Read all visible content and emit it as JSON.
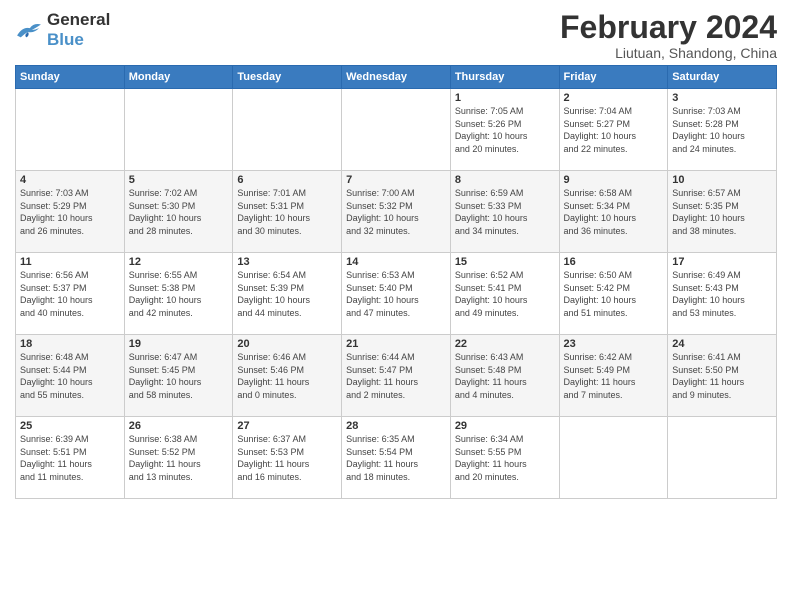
{
  "header": {
    "logo_line1": "General",
    "logo_line2": "Blue",
    "month_year": "February 2024",
    "location": "Liutuan, Shandong, China"
  },
  "weekdays": [
    "Sunday",
    "Monday",
    "Tuesday",
    "Wednesday",
    "Thursday",
    "Friday",
    "Saturday"
  ],
  "weeks": [
    [
      {
        "day": "",
        "info": ""
      },
      {
        "day": "",
        "info": ""
      },
      {
        "day": "",
        "info": ""
      },
      {
        "day": "",
        "info": ""
      },
      {
        "day": "1",
        "info": "Sunrise: 7:05 AM\nSunset: 5:26 PM\nDaylight: 10 hours\nand 20 minutes."
      },
      {
        "day": "2",
        "info": "Sunrise: 7:04 AM\nSunset: 5:27 PM\nDaylight: 10 hours\nand 22 minutes."
      },
      {
        "day": "3",
        "info": "Sunrise: 7:03 AM\nSunset: 5:28 PM\nDaylight: 10 hours\nand 24 minutes."
      }
    ],
    [
      {
        "day": "4",
        "info": "Sunrise: 7:03 AM\nSunset: 5:29 PM\nDaylight: 10 hours\nand 26 minutes."
      },
      {
        "day": "5",
        "info": "Sunrise: 7:02 AM\nSunset: 5:30 PM\nDaylight: 10 hours\nand 28 minutes."
      },
      {
        "day": "6",
        "info": "Sunrise: 7:01 AM\nSunset: 5:31 PM\nDaylight: 10 hours\nand 30 minutes."
      },
      {
        "day": "7",
        "info": "Sunrise: 7:00 AM\nSunset: 5:32 PM\nDaylight: 10 hours\nand 32 minutes."
      },
      {
        "day": "8",
        "info": "Sunrise: 6:59 AM\nSunset: 5:33 PM\nDaylight: 10 hours\nand 34 minutes."
      },
      {
        "day": "9",
        "info": "Sunrise: 6:58 AM\nSunset: 5:34 PM\nDaylight: 10 hours\nand 36 minutes."
      },
      {
        "day": "10",
        "info": "Sunrise: 6:57 AM\nSunset: 5:35 PM\nDaylight: 10 hours\nand 38 minutes."
      }
    ],
    [
      {
        "day": "11",
        "info": "Sunrise: 6:56 AM\nSunset: 5:37 PM\nDaylight: 10 hours\nand 40 minutes."
      },
      {
        "day": "12",
        "info": "Sunrise: 6:55 AM\nSunset: 5:38 PM\nDaylight: 10 hours\nand 42 minutes."
      },
      {
        "day": "13",
        "info": "Sunrise: 6:54 AM\nSunset: 5:39 PM\nDaylight: 10 hours\nand 44 minutes."
      },
      {
        "day": "14",
        "info": "Sunrise: 6:53 AM\nSunset: 5:40 PM\nDaylight: 10 hours\nand 47 minutes."
      },
      {
        "day": "15",
        "info": "Sunrise: 6:52 AM\nSunset: 5:41 PM\nDaylight: 10 hours\nand 49 minutes."
      },
      {
        "day": "16",
        "info": "Sunrise: 6:50 AM\nSunset: 5:42 PM\nDaylight: 10 hours\nand 51 minutes."
      },
      {
        "day": "17",
        "info": "Sunrise: 6:49 AM\nSunset: 5:43 PM\nDaylight: 10 hours\nand 53 minutes."
      }
    ],
    [
      {
        "day": "18",
        "info": "Sunrise: 6:48 AM\nSunset: 5:44 PM\nDaylight: 10 hours\nand 55 minutes."
      },
      {
        "day": "19",
        "info": "Sunrise: 6:47 AM\nSunset: 5:45 PM\nDaylight: 10 hours\nand 58 minutes."
      },
      {
        "day": "20",
        "info": "Sunrise: 6:46 AM\nSunset: 5:46 PM\nDaylight: 11 hours\nand 0 minutes."
      },
      {
        "day": "21",
        "info": "Sunrise: 6:44 AM\nSunset: 5:47 PM\nDaylight: 11 hours\nand 2 minutes."
      },
      {
        "day": "22",
        "info": "Sunrise: 6:43 AM\nSunset: 5:48 PM\nDaylight: 11 hours\nand 4 minutes."
      },
      {
        "day": "23",
        "info": "Sunrise: 6:42 AM\nSunset: 5:49 PM\nDaylight: 11 hours\nand 7 minutes."
      },
      {
        "day": "24",
        "info": "Sunrise: 6:41 AM\nSunset: 5:50 PM\nDaylight: 11 hours\nand 9 minutes."
      }
    ],
    [
      {
        "day": "25",
        "info": "Sunrise: 6:39 AM\nSunset: 5:51 PM\nDaylight: 11 hours\nand 11 minutes."
      },
      {
        "day": "26",
        "info": "Sunrise: 6:38 AM\nSunset: 5:52 PM\nDaylight: 11 hours\nand 13 minutes."
      },
      {
        "day": "27",
        "info": "Sunrise: 6:37 AM\nSunset: 5:53 PM\nDaylight: 11 hours\nand 16 minutes."
      },
      {
        "day": "28",
        "info": "Sunrise: 6:35 AM\nSunset: 5:54 PM\nDaylight: 11 hours\nand 18 minutes."
      },
      {
        "day": "29",
        "info": "Sunrise: 6:34 AM\nSunset: 5:55 PM\nDaylight: 11 hours\nand 20 minutes."
      },
      {
        "day": "",
        "info": ""
      },
      {
        "day": "",
        "info": ""
      }
    ]
  ]
}
